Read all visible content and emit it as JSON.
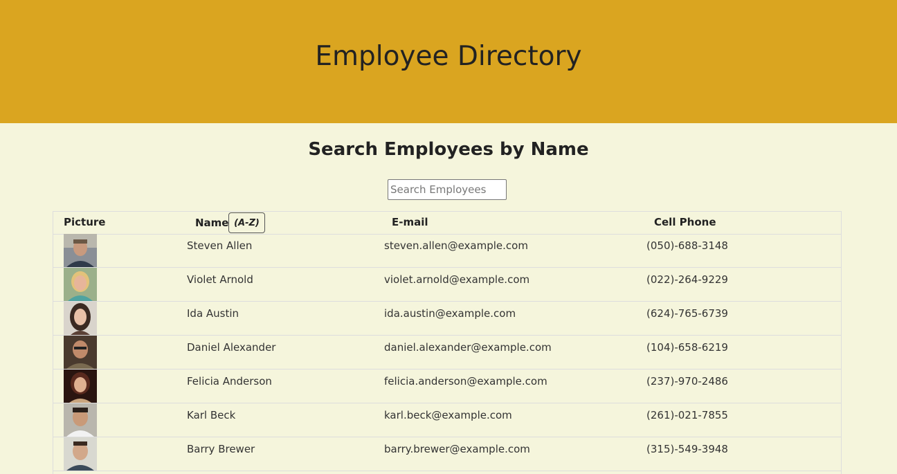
{
  "header": {
    "title": "Employee Directory"
  },
  "search": {
    "title": "Search Employees by Name",
    "placeholder": "Search Employees",
    "value": ""
  },
  "table": {
    "columns": {
      "picture": "Picture",
      "name": "Name",
      "sort_label": "(A-Z)",
      "email": "E-mail",
      "phone": "Cell Phone"
    },
    "rows": [
      {
        "name": "Steven Allen",
        "email": "steven.allen@example.com",
        "phone": "(050)-688-3148"
      },
      {
        "name": "Violet Arnold",
        "email": "violet.arnold@example.com",
        "phone": "(022)-264-9229"
      },
      {
        "name": "Ida Austin",
        "email": "ida.austin@example.com",
        "phone": "(624)-765-6739"
      },
      {
        "name": "Daniel Alexander",
        "email": "daniel.alexander@example.com",
        "phone": "(104)-658-6219"
      },
      {
        "name": "Felicia Anderson",
        "email": "felicia.anderson@example.com",
        "phone": "(237)-970-2486"
      },
      {
        "name": "Karl Beck",
        "email": "karl.beck@example.com",
        "phone": "(261)-021-7855"
      },
      {
        "name": "Barry Brewer",
        "email": "barry.brewer@example.com",
        "phone": "(315)-549-3948"
      }
    ]
  },
  "colors": {
    "header_bg": "#daa520",
    "page_bg": "#f5f5dc"
  }
}
